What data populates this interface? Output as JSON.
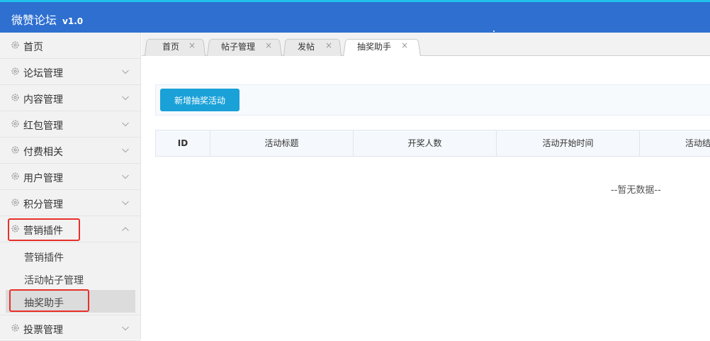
{
  "app": {
    "title": "微赞论坛",
    "version": "v1.0"
  },
  "sidebar": {
    "items": [
      {
        "label": "首页",
        "has_chevron": false
      },
      {
        "label": "论坛管理",
        "has_chevron": true
      },
      {
        "label": "内容管理",
        "has_chevron": true
      },
      {
        "label": "红包管理",
        "has_chevron": true
      },
      {
        "label": "付费相关",
        "has_chevron": true
      },
      {
        "label": "用户管理",
        "has_chevron": true
      },
      {
        "label": "积分管理",
        "has_chevron": true
      },
      {
        "label": "营销插件",
        "has_chevron": true,
        "expanded": true
      }
    ],
    "subitems": [
      {
        "label": "营销插件"
      },
      {
        "label": "活动帖子管理"
      },
      {
        "label": "抽奖助手",
        "active": true
      }
    ],
    "last_item": {
      "label": "投票管理"
    }
  },
  "tabs": [
    {
      "label": "首页",
      "close": "×"
    },
    {
      "label": "帖子管理",
      "close": "×"
    },
    {
      "label": "发帖",
      "close": "×"
    },
    {
      "label": "抽奖助手",
      "close": "×",
      "active": true
    }
  ],
  "toolbar": {
    "add_label": "新增抽奖活动"
  },
  "table": {
    "columns": [
      "ID",
      "活动标题",
      "开奖人数",
      "活动开始时间",
      "活动结束时间"
    ],
    "empty_text": "--暂无数据--"
  },
  "colors": {
    "header_bg": "#2e6fd0",
    "accent_button": "#1aa1d8",
    "highlight_box": "#e8302a"
  }
}
